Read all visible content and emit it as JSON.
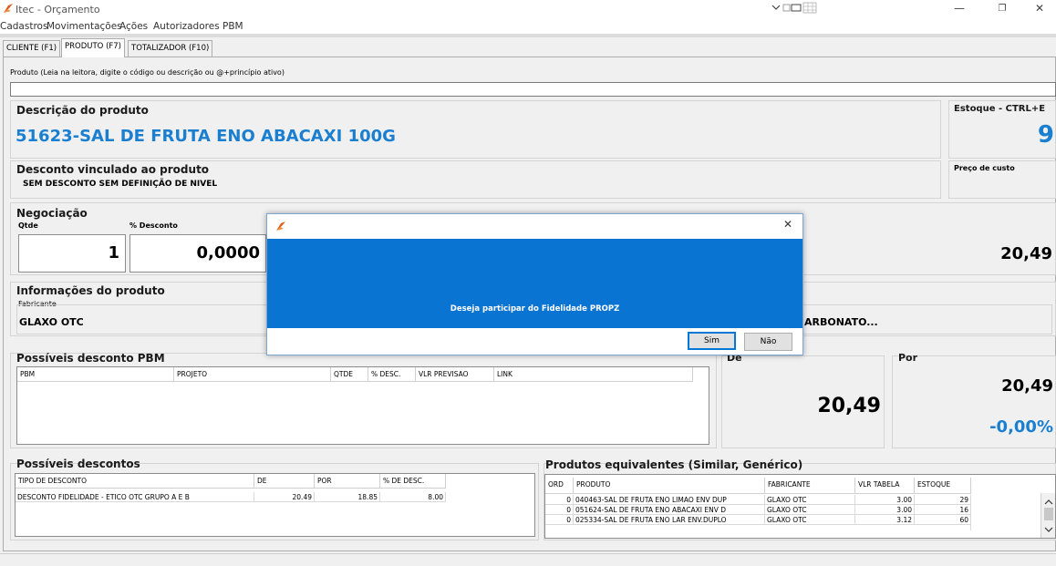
{
  "window": {
    "title": "Itec - Orçamento",
    "minimize": "—",
    "maximize": "❐",
    "close": "✕",
    "accent_color": "#e05a1b"
  },
  "menu": [
    "Cadastros",
    "Movimentações",
    "Ações",
    "Autorizadores PBM"
  ],
  "tabs": [
    "CLIENTE (F1)",
    "PRODUTO (F7)",
    "TOTALIZADOR (F10)"
  ],
  "produto": {
    "label": "Produto (Leia na leitora, digite o código ou descrição ou @+princípio ativo)",
    "value": ""
  },
  "descricao": {
    "title": "Descrição do produto",
    "value": "51623-SAL DE FRUTA ENO ABACAXI 100G",
    "color": "#1a7fd0"
  },
  "estoque": {
    "title": "Estoque - CTRL+E",
    "value": "9"
  },
  "desconto_vinculado": {
    "title": "Desconto vinculado ao produto",
    "value": "SEM DESCONTO SEM DEFINIÇÃO DE NIVEL"
  },
  "preco_custo": {
    "title": "Preço de custo"
  },
  "negociacao": {
    "title": "Negociação",
    "qtde_label": "Qtde",
    "qtde": "1",
    "desconto_label": "% Desconto",
    "desconto": "0,0000",
    "preco": "20,49"
  },
  "informacoes": {
    "title": "Informações do produto",
    "fabricante_label": "Fabricante",
    "fabricante": "GLAXO OTC",
    "principio_partial": "ARBONATO..."
  },
  "pbm": {
    "title": "Possíveis desconto PBM",
    "columns": [
      "PBM",
      "PROJETO",
      "QTDE",
      "% DESC.",
      "VLR PREVISAO",
      "LINK"
    ]
  },
  "de": {
    "title": "De",
    "value": "20,49"
  },
  "por": {
    "title": "Por",
    "value": "20,49",
    "percent": "-0,00%"
  },
  "descontos": {
    "title": "Possíveis descontos",
    "columns": [
      "TIPO DE DESCONTO",
      "DE",
      "POR",
      "% DE DESC."
    ],
    "rows": [
      [
        "DESCONTO FIDELIDADE - ETICO OTC GRUPO A E B",
        "20.49",
        "18.85",
        "8.00"
      ]
    ]
  },
  "equivalentes": {
    "title": "Produtos equivalentes (Similar, Genérico)",
    "columns": [
      "ORD",
      "PRODUTO",
      "FABRICANTE",
      "VLR TABELA",
      "ESTOQUE"
    ],
    "rows": [
      [
        "0",
        "040463-SAL DE FRUTA ENO LIMAO ENV DUP",
        "GLAXO OTC",
        "3.00",
        "29"
      ],
      [
        "0",
        "051624-SAL DE FRUTA ENO ABACAXI ENV D",
        "GLAXO OTC",
        "3.00",
        "16"
      ],
      [
        "0",
        "025334-SAL DE FRUTA ENO LAR ENV.DUPLO",
        "GLAXO OTC",
        "3.12",
        "60"
      ]
    ]
  },
  "dialog": {
    "close": "✕",
    "message": "Deseja participar do Fidelidade PROPZ",
    "yes": "Sim",
    "no": "Não",
    "body_color": "#0a74d3"
  }
}
